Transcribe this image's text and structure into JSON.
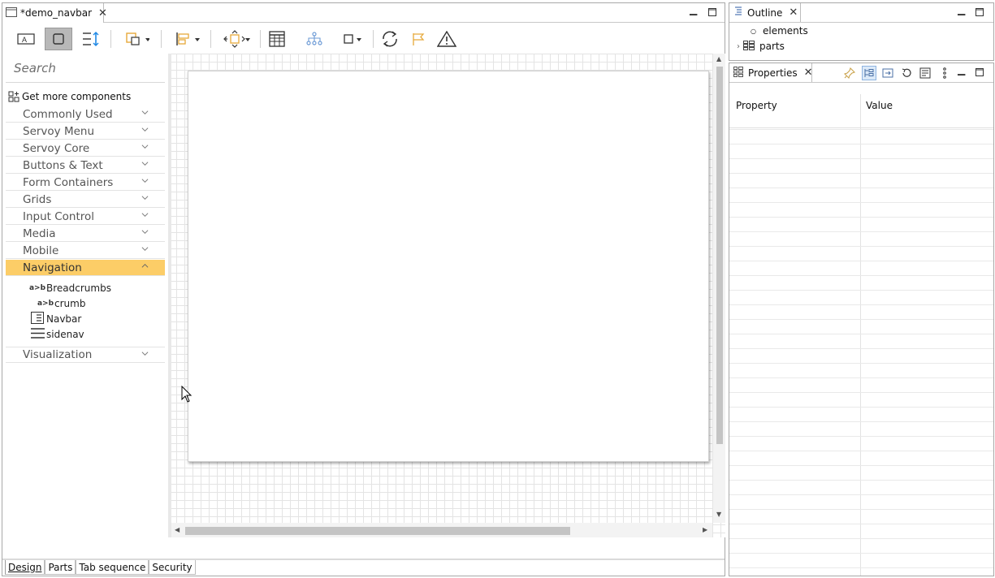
{
  "editor": {
    "tab_title": "*demo_navbar",
    "bottom_tabs": [
      "Design",
      "Parts",
      "Tab sequence",
      "Security"
    ]
  },
  "palette": {
    "search_placeholder": "Search",
    "get_more": "Get more components",
    "categories": [
      "Commonly Used",
      "Servoy Menu",
      "Servoy Core",
      "Buttons & Text",
      "Form Containers",
      "Grids",
      "Input Control",
      "Media",
      "Mobile",
      "Navigation",
      "Visualization"
    ],
    "active_category": "Navigation",
    "navigation_components": [
      {
        "label": "Breadcrumbs",
        "icon": "a>b"
      },
      {
        "label": "crumb",
        "icon": "a>b"
      },
      {
        "label": "Navbar",
        "icon": "navbar-icon"
      },
      {
        "label": "sidenav",
        "icon": "hamburger-icon"
      }
    ]
  },
  "outline": {
    "title": "Outline",
    "items": [
      "elements",
      "parts"
    ]
  },
  "properties": {
    "title": "Properties",
    "col_property": "Property",
    "col_value": "Value"
  },
  "colors": {
    "active_category_bg": "#fccd67",
    "accent_blue": "#1e88e5"
  }
}
